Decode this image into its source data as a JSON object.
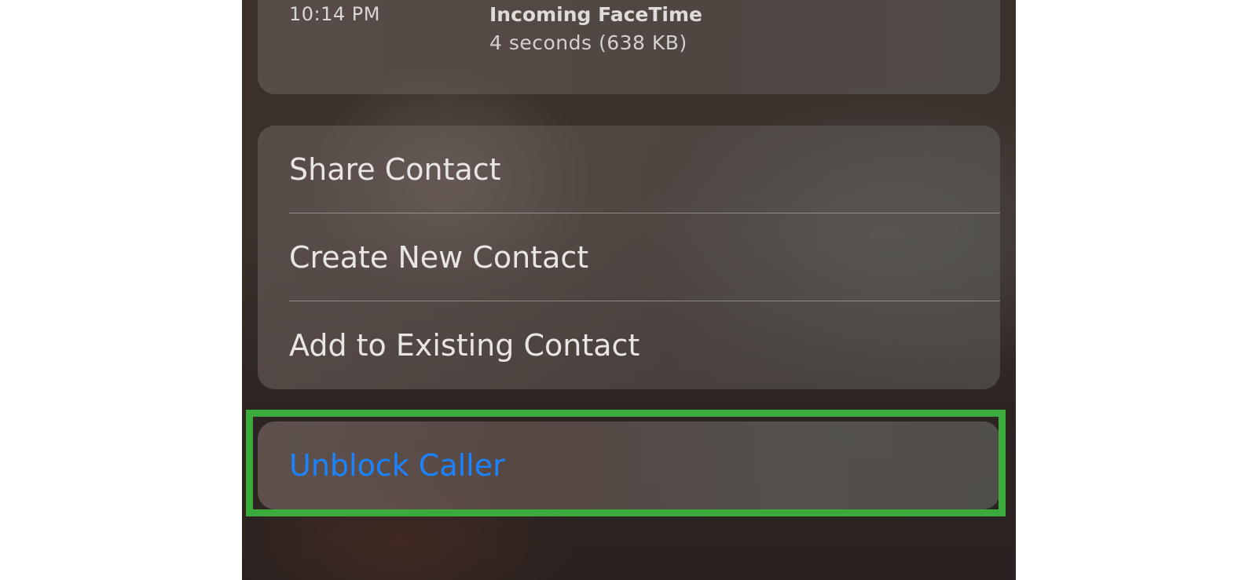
{
  "call_history": {
    "time": "10:14 PM",
    "type": "Incoming FaceTime",
    "detail": "4 seconds (638 KB)"
  },
  "actions": [
    {
      "label": "Share Contact"
    },
    {
      "label": "Create New Contact"
    },
    {
      "label": "Add to Existing Contact"
    }
  ],
  "unblock": {
    "label": "Unblock Caller",
    "color": "#1a84ff"
  },
  "highlight_color": "#3bab3e"
}
